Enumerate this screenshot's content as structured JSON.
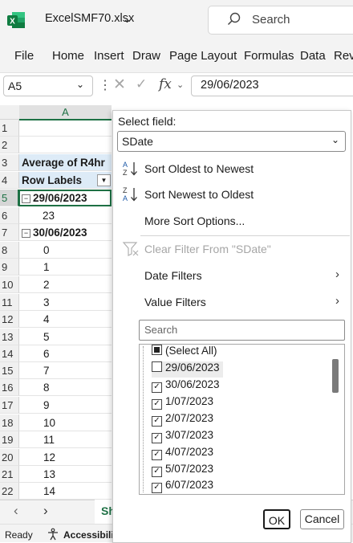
{
  "titlebar": {
    "filename": "ExcelSMF70.xlsx",
    "filename_chevron": "chevron-down-icon",
    "search_placeholder": "Search"
  },
  "ribbon": {
    "tabs": [
      "File",
      "Home",
      "Insert",
      "Draw",
      "Page Layout",
      "Formulas",
      "Data",
      "Revi"
    ]
  },
  "formula_bar": {
    "name_box": "A5",
    "fx_label": "fx",
    "formula": "29/06/2023"
  },
  "grid": {
    "column_header": "A",
    "row_numbers": [
      "1",
      "2",
      "3",
      "4",
      "5",
      "6",
      "7",
      "8",
      "9",
      "10",
      "11",
      "12",
      "13",
      "14",
      "15",
      "16",
      "17",
      "18",
      "19",
      "20",
      "21",
      "22"
    ],
    "cells": {
      "r3": "Average of R4hr",
      "r4": "Row Labels",
      "r5": "29/06/2023",
      "r6": "23",
      "r7": "30/06/2023",
      "r8": "0",
      "r9": "1",
      "r10": "2",
      "r11": "3",
      "r12": "4",
      "r13": "5",
      "r14": "6",
      "r15": "7",
      "r16": "8",
      "r17": "9",
      "r18": "10",
      "r19": "11",
      "r20": "12",
      "r21": "13",
      "r22": "14"
    }
  },
  "sheetbar": {
    "sheet_tab": "Sh"
  },
  "statusbar": {
    "ready": "Ready",
    "accessibility": "Accessibili"
  },
  "filter_panel": {
    "select_field_label": "Select field:",
    "selected_field": "SDate",
    "menu": {
      "sort_oldest": "Sort Oldest to Newest",
      "sort_newest": "Sort Newest to Oldest",
      "more_sort": "More Sort Options...",
      "clear_filter": "Clear Filter From \"SDate\"",
      "date_filters": "Date Filters",
      "value_filters": "Value Filters"
    },
    "search_placeholder": "Search",
    "items": [
      {
        "label": "(Select All)",
        "state": "partial"
      },
      {
        "label": "29/06/2023",
        "state": "unchecked"
      },
      {
        "label": "30/06/2023",
        "state": "checked"
      },
      {
        "label": "1/07/2023",
        "state": "checked"
      },
      {
        "label": "2/07/2023",
        "state": "checked"
      },
      {
        "label": "3/07/2023",
        "state": "checked"
      },
      {
        "label": "4/07/2023",
        "state": "checked"
      },
      {
        "label": "5/07/2023",
        "state": "checked"
      },
      {
        "label": "6/07/2023",
        "state": "checked"
      }
    ],
    "ok": "OK",
    "cancel": "Cancel"
  },
  "colors": {
    "excel_green": "#1e7145",
    "pivot_header_fill": "#ddebf7"
  }
}
